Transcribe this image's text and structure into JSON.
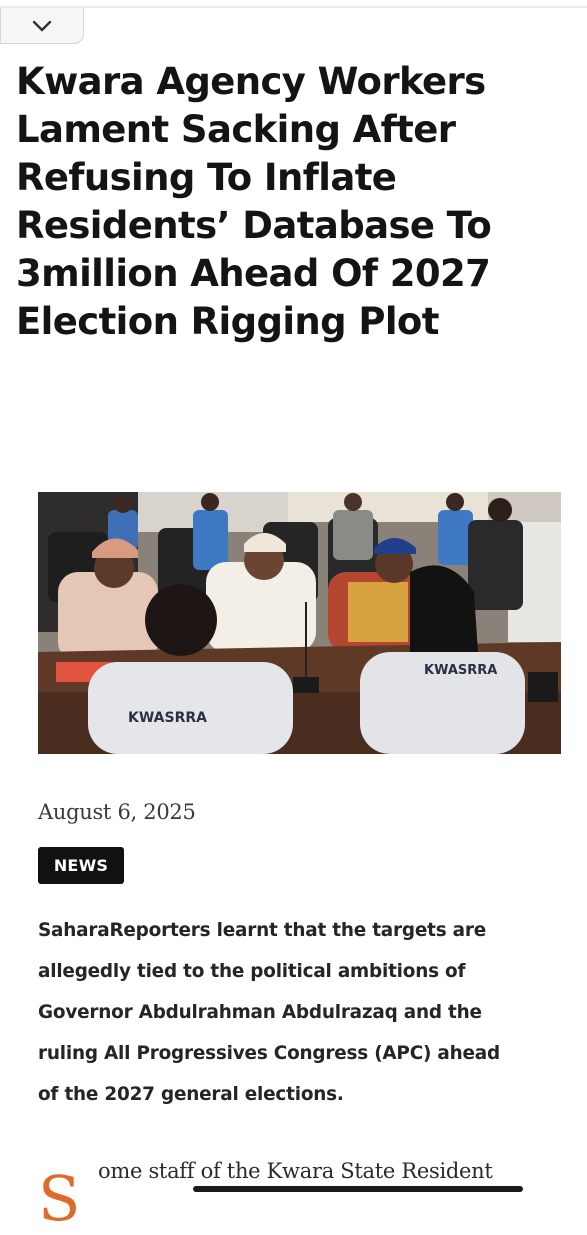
{
  "toolbar": {
    "collapse_icon": "chevron-down-icon"
  },
  "article": {
    "headline_lines": [
      "Kwara Agency Workers",
      "Lament Sacking After",
      "Refusing To Inflate",
      "Residents’ Database To",
      "3million Ahead Of 2027",
      "Election Rigging Plot"
    ],
    "photo": {
      "shirt_text_left": "KWASRRA",
      "shirt_text_right": "KWASRRA"
    },
    "date": "August 6, 2025",
    "category": "NEWS",
    "summary_lines": [
      "SaharaReporters learnt that the targets are",
      "allegedly tied to the political ambitions of",
      "Governor Abdulrahman Abdulrazaq and the",
      "ruling All Progressives Congress (APC) ahead",
      "of the 2027 general elections."
    ],
    "body_dropcap": "S",
    "body_first_line": "ome staff of the Kwara State Resident"
  },
  "colors": {
    "dropcap": "#e06a2c",
    "badge_bg": "#111111",
    "headline": "#141414"
  }
}
